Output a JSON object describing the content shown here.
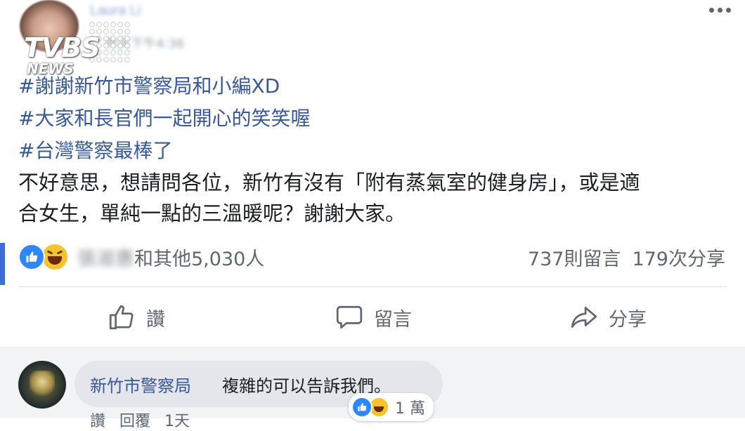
{
  "post": {
    "author_name": "Laura Li",
    "timestamp": "昨天下午4:36",
    "watermark": {
      "brand": "TVBS",
      "sub": "NEWS"
    },
    "hashtags": [
      "#謝謝新竹市警察局和小編XD",
      "#大家和長官們一起開心的笑笑喔",
      "#台灣警察最棒了"
    ],
    "body_lines": [
      "不好意思，想請問各位，新竹有沒有「附有蒸氣室的健身房」，或是適",
      "合女生，單純一點的三溫暖呢？謝謝大家。"
    ]
  },
  "reactions": {
    "types": [
      "like",
      "haha"
    ],
    "reactor_name": "張淑惠",
    "others_text": "和其他5,030人",
    "comments_count": "737則留言",
    "shares_count": "179次分享"
  },
  "actions": {
    "like": "讚",
    "comment": "留言",
    "share": "分享"
  },
  "comment": {
    "author": "新竹市警察局",
    "text": "複雜的可以告訴我們。",
    "reaction_count": "1 萬",
    "actions": [
      "讚",
      "回覆",
      "1天"
    ]
  },
  "colors": {
    "link": "#385898",
    "like_blue": "#2d88ff",
    "haha_yellow": "#f7c22e",
    "muted": "#606770"
  }
}
